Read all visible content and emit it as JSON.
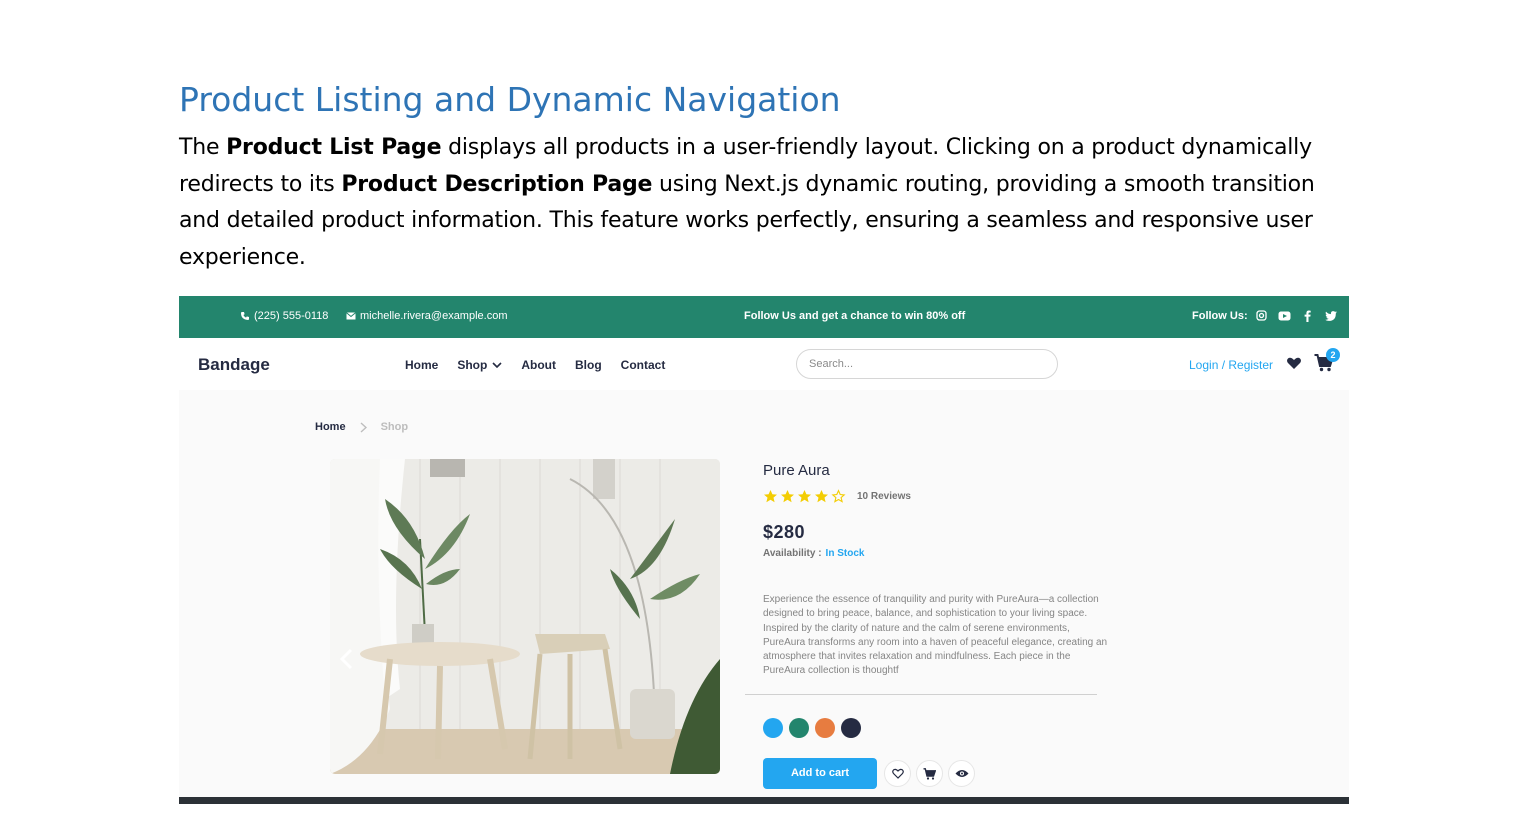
{
  "document": {
    "heading": "Product Listing and Dynamic Navigation",
    "para_1": "The ",
    "para_bold_1": "Product List Page",
    "para_2": " displays all products in a user-friendly layout. Clicking on a product dynamically redirects to its ",
    "para_bold_2": "Product Description Page",
    "para_3": " using Next.js dynamic routing, providing a smooth transition and detailed product information. This feature works perfectly, ensuring a seamless and responsive user experience."
  },
  "topbar": {
    "phone": "(225) 555-0118",
    "email": "michelle.rivera@example.com",
    "promo": "Follow Us and get a chance to win 80% off",
    "follow_label": "Follow Us:",
    "socials": [
      "instagram-icon",
      "youtube-icon",
      "facebook-icon",
      "twitter-icon"
    ],
    "color": "#23856d"
  },
  "navbar": {
    "brand": "Bandage",
    "links": [
      "Home",
      "Shop",
      "About",
      "Blog",
      "Contact"
    ],
    "search_placeholder": "Search...",
    "login": "Login / Register",
    "cart_count": "2",
    "accent": "#23a6f0"
  },
  "breadcrumb": {
    "home": "Home",
    "current": "Shop"
  },
  "product": {
    "name": "Pure Aura",
    "rating": 4,
    "rating_max": 5,
    "reviews": "10 Reviews",
    "price": "$280",
    "availability_label": "Availability :",
    "availability_value": "In Stock",
    "description": "Experience the essence of tranquility and purity with PureAura—a collection designed to bring peace, balance, and sophistication to your living space. Inspired by the clarity of nature and the calm of serene environments, PureAura transforms any room into a haven of peaceful elegance, creating an atmosphere that invites relaxation and mindfulness. Each piece in the PureAura collection is thoughtf",
    "colors": [
      "#23a6f0",
      "#23856d",
      "#e77c40",
      "#252b42"
    ],
    "add_to_cart": "Add to cart"
  }
}
